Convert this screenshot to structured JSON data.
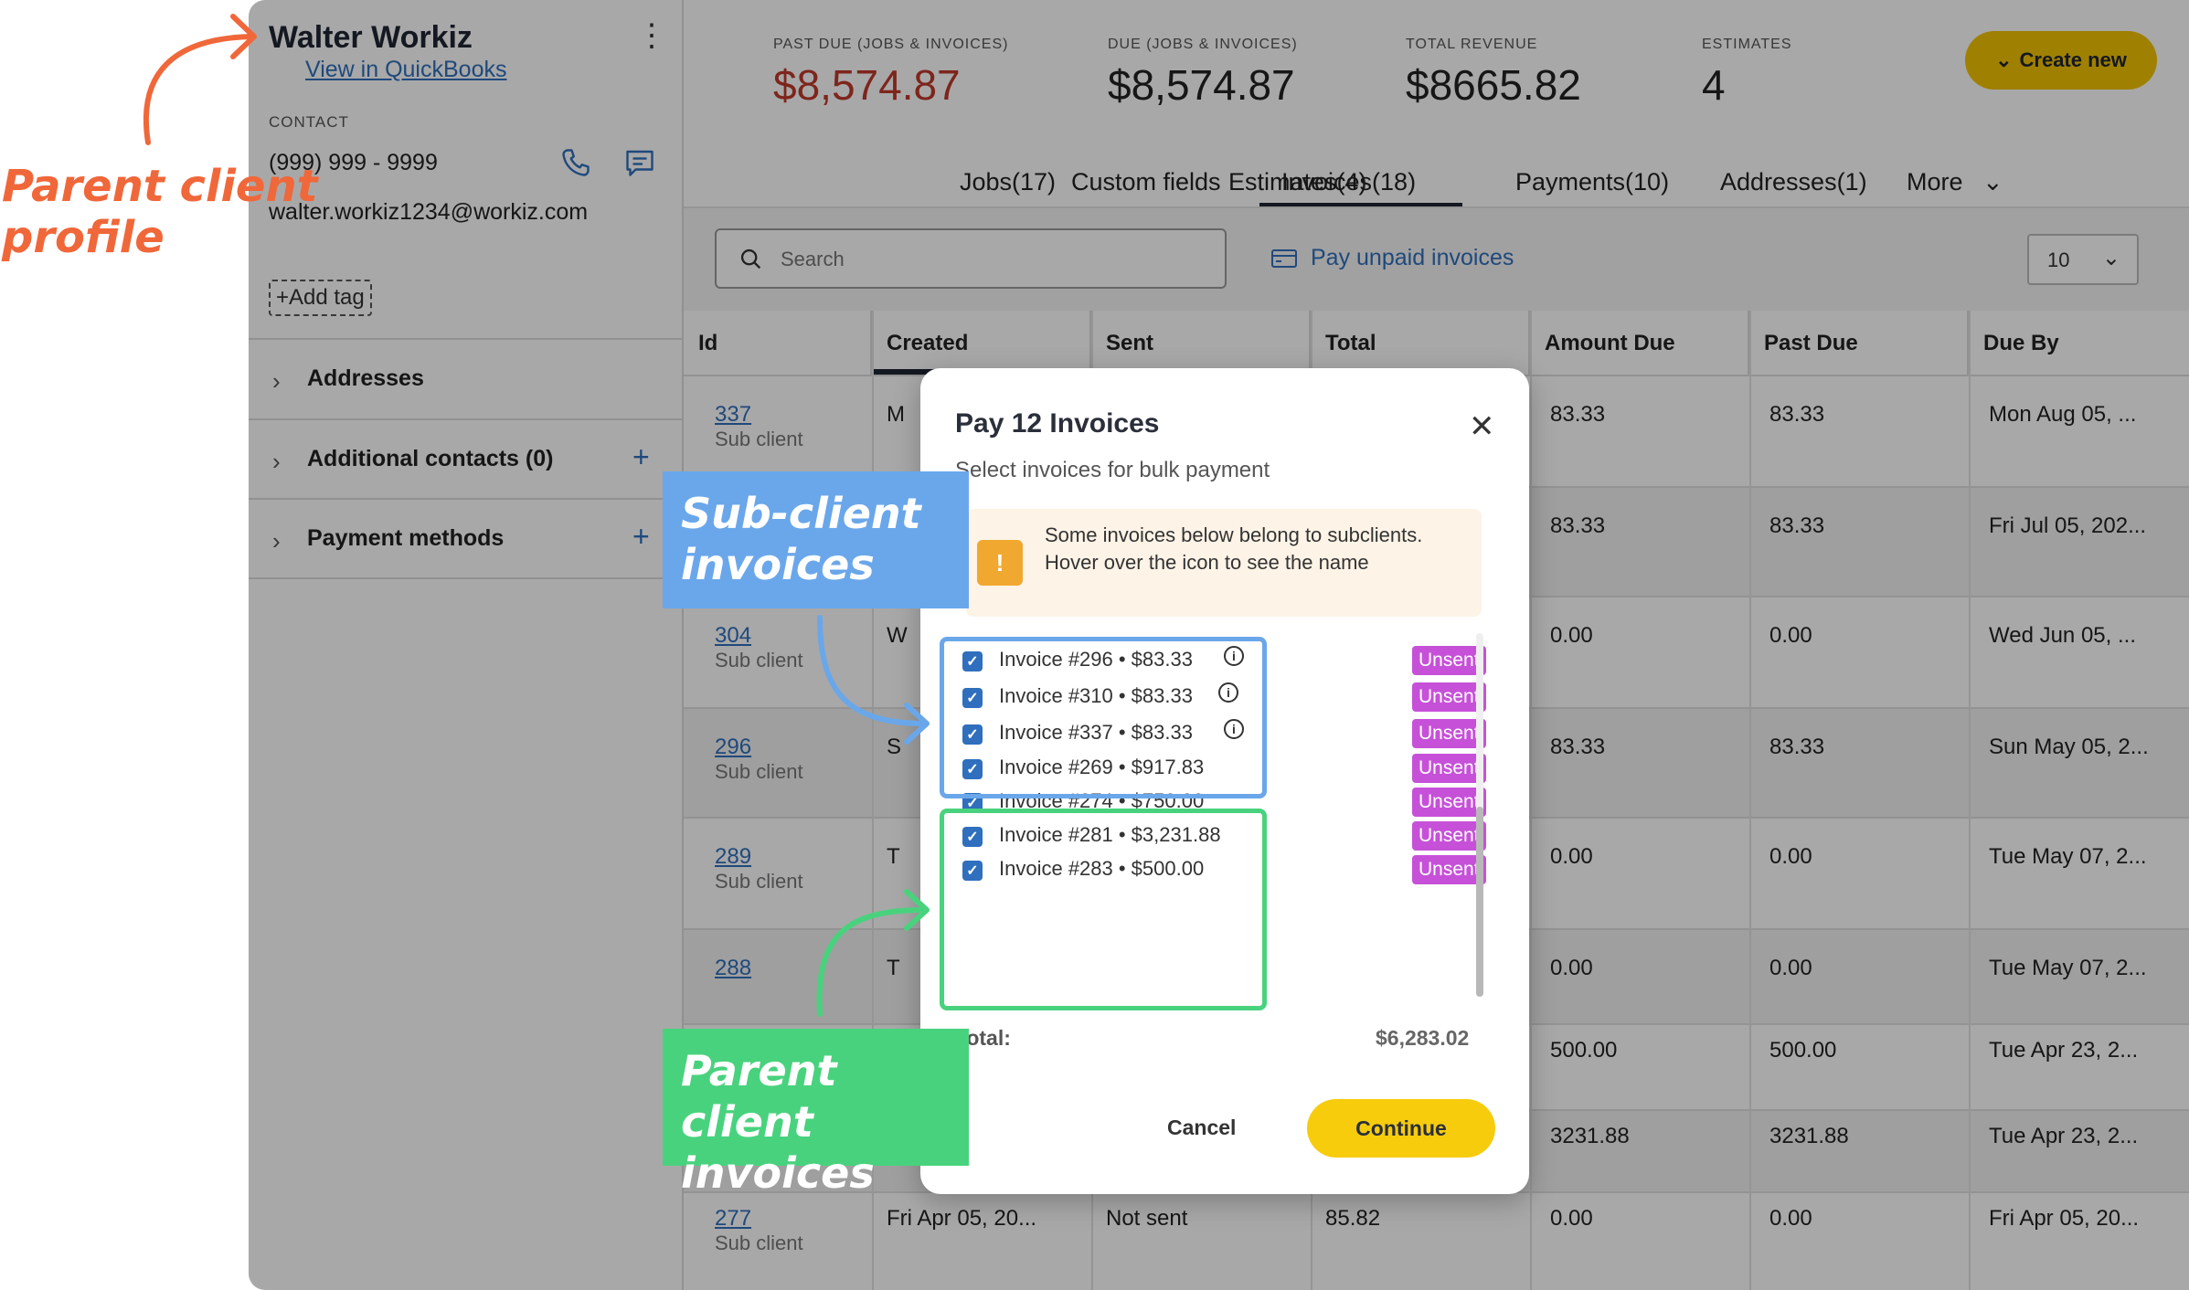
{
  "sidebar": {
    "client_name": "Walter Workiz",
    "view_link": "View in QuickBooks",
    "contact_label": "CONTACT",
    "phone": "(999) 999 - 9999",
    "email": "walter.workiz1234@workiz.com",
    "add_tag": "+Add tag",
    "sections": [
      {
        "label": "Addresses"
      },
      {
        "label": "Additional contacts (0)"
      },
      {
        "label": "Payment methods"
      }
    ]
  },
  "stats": [
    {
      "label": "PAST DUE (JOBS & INVOICES)",
      "value": "$8,574.87"
    },
    {
      "label": "DUE (JOBS & INVOICES)",
      "value": "$8,574.87"
    },
    {
      "label": "TOTAL REVENUE",
      "value": "$8665.82"
    },
    {
      "label": "ESTIMATES",
      "value": "4"
    }
  ],
  "create_new": "Create new",
  "tabs": [
    "Jobs(17)",
    "Custom fields",
    "Estimates(4)",
    "Invoices(18)",
    "Payments(10)",
    "Addresses(1)",
    "More"
  ],
  "active_tab": "Invoices(18)",
  "search": {
    "placeholder": "Search"
  },
  "pay_unpaid": "Pay unpaid invoices",
  "per_page": "10",
  "table": {
    "headers": [
      "Id",
      "Created",
      "Sent",
      "Total",
      "Amount Due",
      "Past Due",
      "Due By"
    ],
    "rows": [
      {
        "id": "337",
        "sub": "Sub client",
        "created": "M",
        "sent": "",
        "total": "",
        "amount_due": "83.33",
        "past_due": "83.33",
        "due_by": "Mon Aug 05, ..."
      },
      {
        "id": "",
        "sub": "",
        "created": "",
        "sent": "",
        "total": "",
        "amount_due": "83.33",
        "past_due": "83.33",
        "due_by": "Fri Jul 05, 202..."
      },
      {
        "id": "304",
        "sub": "Sub client",
        "created": "W",
        "sent": "",
        "total": "",
        "amount_due": "0.00",
        "past_due": "0.00",
        "due_by": "Wed Jun 05, ..."
      },
      {
        "id": "296",
        "sub": "Sub client",
        "created": "S",
        "sent": "",
        "total": "",
        "amount_due": "83.33",
        "past_due": "83.33",
        "due_by": "Sun May 05, 2..."
      },
      {
        "id": "289",
        "sub": "Sub client",
        "created": "T",
        "sent": "",
        "total": "",
        "amount_due": "0.00",
        "past_due": "0.00",
        "due_by": "Tue May 07, 2..."
      },
      {
        "id": "288",
        "sub": "",
        "created": "T",
        "sent": "",
        "total": "",
        "amount_due": "0.00",
        "past_due": "0.00",
        "due_by": "Tue May 07, 2..."
      },
      {
        "id": "",
        "sub": "",
        "created": "",
        "sent": "",
        "total": "",
        "amount_due": "500.00",
        "past_due": "500.00",
        "due_by": "Tue Apr 23, 2..."
      },
      {
        "id": "",
        "sub": "",
        "created": "",
        "sent": "",
        "total": "",
        "amount_due": "3231.88",
        "past_due": "3231.88",
        "due_by": "Tue Apr 23, 2..."
      },
      {
        "id": "277",
        "sub": "Sub client",
        "created": "Fri Apr 05, 20...",
        "sent": "Not sent",
        "total": "85.82",
        "amount_due": "0.00",
        "past_due": "0.00",
        "due_by": "Fri Apr 05, 20..."
      }
    ]
  },
  "modal": {
    "title": "Pay 12 Invoices",
    "subtitle": "Select invoices for bulk payment",
    "warning": "Some invoices below belong to subclients. Hover over the icon to see the name",
    "invoices": [
      {
        "label": "Invoice #296 • $83.33",
        "status": "Unsent",
        "checked": true,
        "info": true
      },
      {
        "label": "Invoice #310 • $83.33",
        "status": "Unsent",
        "checked": true,
        "info": true
      },
      {
        "label": "Invoice #337 • $83.33",
        "status": "Unsent",
        "checked": true,
        "info": true
      },
      {
        "label": "Invoice #269 • $917.83",
        "status": "Unsent",
        "checked": true,
        "info": false
      },
      {
        "label": "Invoice #274 • $750.00",
        "status": "Unsent",
        "checked": true,
        "info": false
      },
      {
        "label": "Invoice #281 • $3,231.88",
        "status": "Unsent",
        "checked": true,
        "info": false
      },
      {
        "label": "Invoice #283 • $500.00",
        "status": "Unsent",
        "checked": true,
        "info": false
      }
    ],
    "total_label": "Total:",
    "total_value": "$6,283.02",
    "cancel": "Cancel",
    "continue": "Continue"
  },
  "annotations": {
    "parent_profile": [
      "Parent client",
      "profile"
    ],
    "sub_client": [
      "Sub-client",
      "invoices"
    ],
    "parent_invoices": [
      "Parent client",
      "invoices"
    ]
  },
  "colors": {
    "brand_yellow": "#f7cc0d",
    "link_blue": "#2f6fbd",
    "past_due_red": "#c0392b",
    "badge_purple": "#c651d8",
    "callout_blue": "#6aa7ea",
    "callout_green": "#49d27e",
    "annotation_orange": "#f0673a"
  }
}
